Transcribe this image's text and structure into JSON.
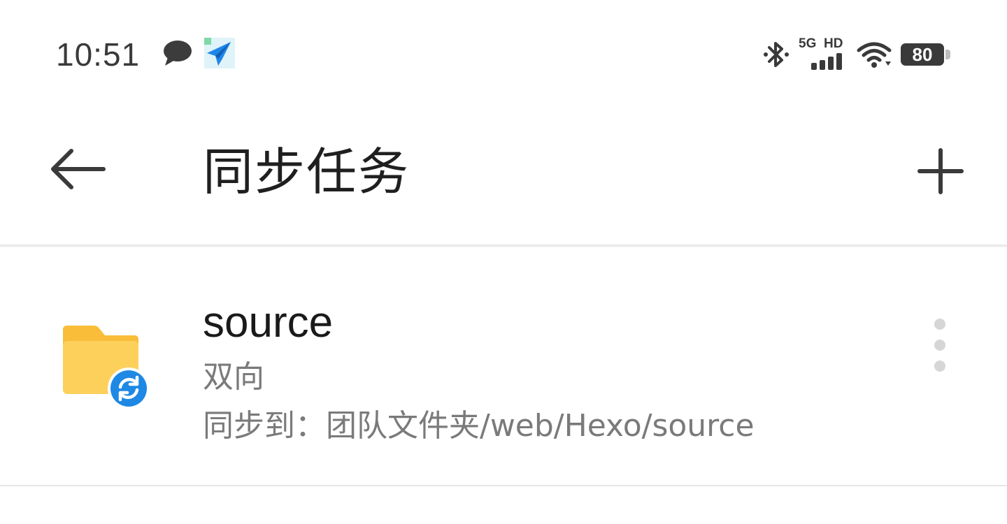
{
  "status_bar": {
    "time": "10:51",
    "left_icons": [
      "chat-bubble-icon",
      "paper-plane-icon"
    ],
    "network_type": "5G",
    "hd_label": "HD",
    "battery_level": "80",
    "right_icons": [
      "bluetooth-icon",
      "signal-icon",
      "wifi-icon",
      "battery-icon"
    ]
  },
  "app_bar": {
    "title": "同步任务",
    "back_icon": "arrow-left-icon",
    "add_icon": "plus-icon"
  },
  "tasks": [
    {
      "name": "source",
      "mode": "双向",
      "destination_label": "同步到：",
      "destination_path": "团队文件夹/web/Hexo/source",
      "icon": "folder-sync-icon",
      "more_icon": "more-vertical-icon"
    }
  ],
  "colors": {
    "folder": "#FDD05C",
    "folder_tab": "#F9BD3A",
    "sync_badge": "#1E88E5",
    "title_text": "#1f1f1f",
    "secondary_text": "#7a7a7a",
    "divider": "#e6e6e6"
  }
}
